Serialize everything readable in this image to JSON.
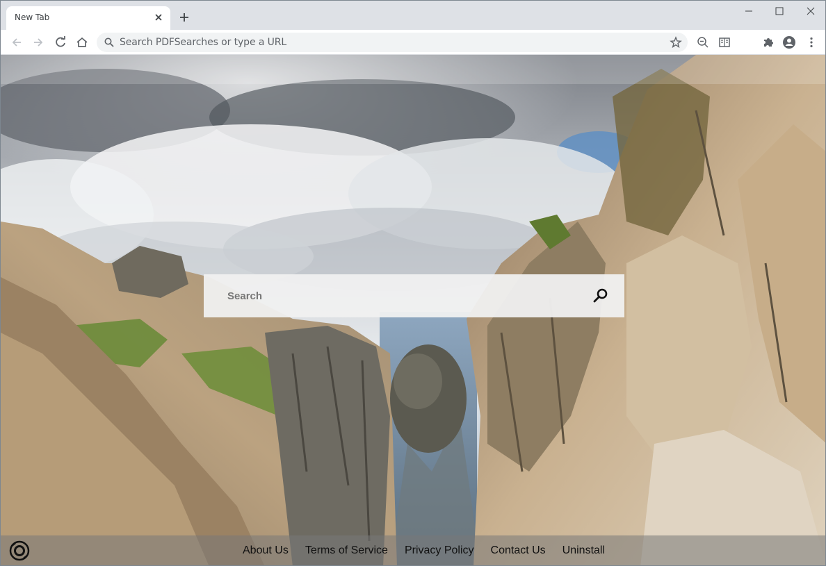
{
  "browser": {
    "tab": {
      "title": "New Tab"
    },
    "omnibox": {
      "placeholder": "Search PDFSearches or type a URL"
    },
    "icons": {
      "tab_close": "close-icon",
      "new_tab": "plus-icon",
      "minimize": "minimize-icon",
      "maximize": "maximize-icon",
      "close_window": "close-icon",
      "back": "back-arrow-icon",
      "forward": "forward-arrow-icon",
      "reload": "reload-icon",
      "home": "home-icon",
      "search": "search-icon",
      "bookmark": "star-icon",
      "zoom": "zoom-out-icon",
      "reader": "reading-mode-icon",
      "extensions": "puzzle-icon",
      "profile": "profile-icon",
      "menu": "kebab-menu-icon"
    }
  },
  "page": {
    "search": {
      "placeholder": "Search"
    },
    "footer": {
      "links": [
        {
          "label": "About Us"
        },
        {
          "label": "Terms of Service"
        },
        {
          "label": "Privacy Policy"
        },
        {
          "label": "Contact Us"
        },
        {
          "label": "Uninstall"
        }
      ]
    }
  },
  "colors": {
    "tabstrip": "#dee1e6",
    "omnibox": "#f1f3f4",
    "icon": "#5f6368"
  }
}
